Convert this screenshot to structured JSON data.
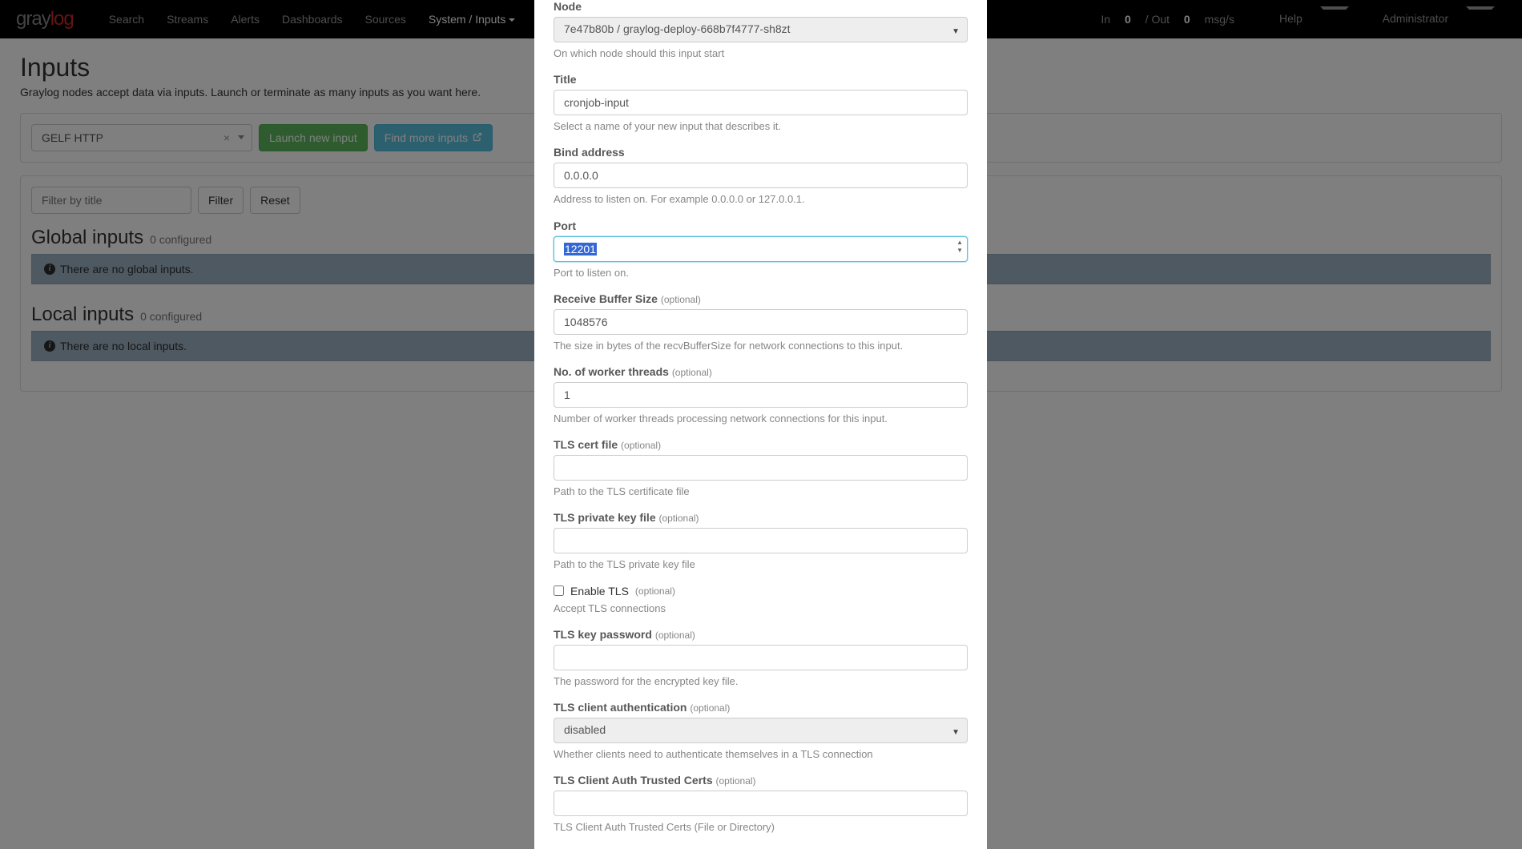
{
  "brand": {
    "p1": "gray",
    "p2": "log"
  },
  "nav": {
    "search": "Search",
    "streams": "Streams",
    "alerts": "Alerts",
    "dashboards": "Dashboards",
    "sources": "Sources",
    "system": "System / Inputs"
  },
  "navright": {
    "status_prefix": "In ",
    "status_in": "0",
    "status_mid": " / Out ",
    "status_out": "0",
    "status_suffix": " msg/s",
    "help": "Help",
    "admin": "Administrator"
  },
  "page": {
    "title": "Inputs",
    "desc": "Graylog nodes accept data via inputs. Launch or terminate as many inputs as you want here."
  },
  "launchbar": {
    "input_type_value": "GELF HTTP",
    "launch": "Launch new input",
    "find": "Find more inputs"
  },
  "filter": {
    "placeholder": "Filter by title",
    "filter_btn": "Filter",
    "reset_btn": "Reset"
  },
  "sections": {
    "global_title": "Global inputs",
    "global_count": "0 configured",
    "global_empty": "There are no global inputs.",
    "local_title": "Local inputs",
    "local_count": "0 configured",
    "local_empty": "There are no local inputs."
  },
  "modal": {
    "node": {
      "label": "Node",
      "value": "7e47b80b / graylog-deploy-668b7f4777-sh8zt",
      "help": "On which node should this input start"
    },
    "title": {
      "label": "Title",
      "value": "cronjob-input",
      "help": "Select a name of your new input that describes it."
    },
    "bind": {
      "label": "Bind address",
      "value": "0.0.0.0",
      "help": "Address to listen on. For example 0.0.0.0 or 127.0.0.1."
    },
    "port": {
      "label": "Port",
      "value": "12201",
      "help": "Port to listen on."
    },
    "recvbuf": {
      "label": "Receive Buffer Size",
      "opt": "(optional)",
      "value": "1048576",
      "help": "The size in bytes of the recvBufferSize for network connections to this input."
    },
    "workers": {
      "label": "No. of worker threads",
      "opt": "(optional)",
      "value": "1",
      "help": "Number of worker threads processing network connections for this input."
    },
    "tlscert": {
      "label": "TLS cert file",
      "opt": "(optional)",
      "value": "",
      "help": "Path to the TLS certificate file"
    },
    "tlskey": {
      "label": "TLS private key file",
      "opt": "(optional)",
      "value": "",
      "help": "Path to the TLS private key file"
    },
    "enabletls": {
      "label": "Enable TLS",
      "opt": "(optional)",
      "help": "Accept TLS connections"
    },
    "tlspass": {
      "label": "TLS key password",
      "opt": "(optional)",
      "value": "",
      "help": "The password for the encrypted key file."
    },
    "tlsauth": {
      "label": "TLS client authentication",
      "opt": "(optional)",
      "value": "disabled",
      "help": "Whether clients need to authenticate themselves in a TLS connection"
    },
    "tlscerts": {
      "label": "TLS Client Auth Trusted Certs",
      "opt": "(optional)",
      "value": "",
      "help": "TLS Client Auth Trusted Certs (File or Directory)"
    }
  }
}
